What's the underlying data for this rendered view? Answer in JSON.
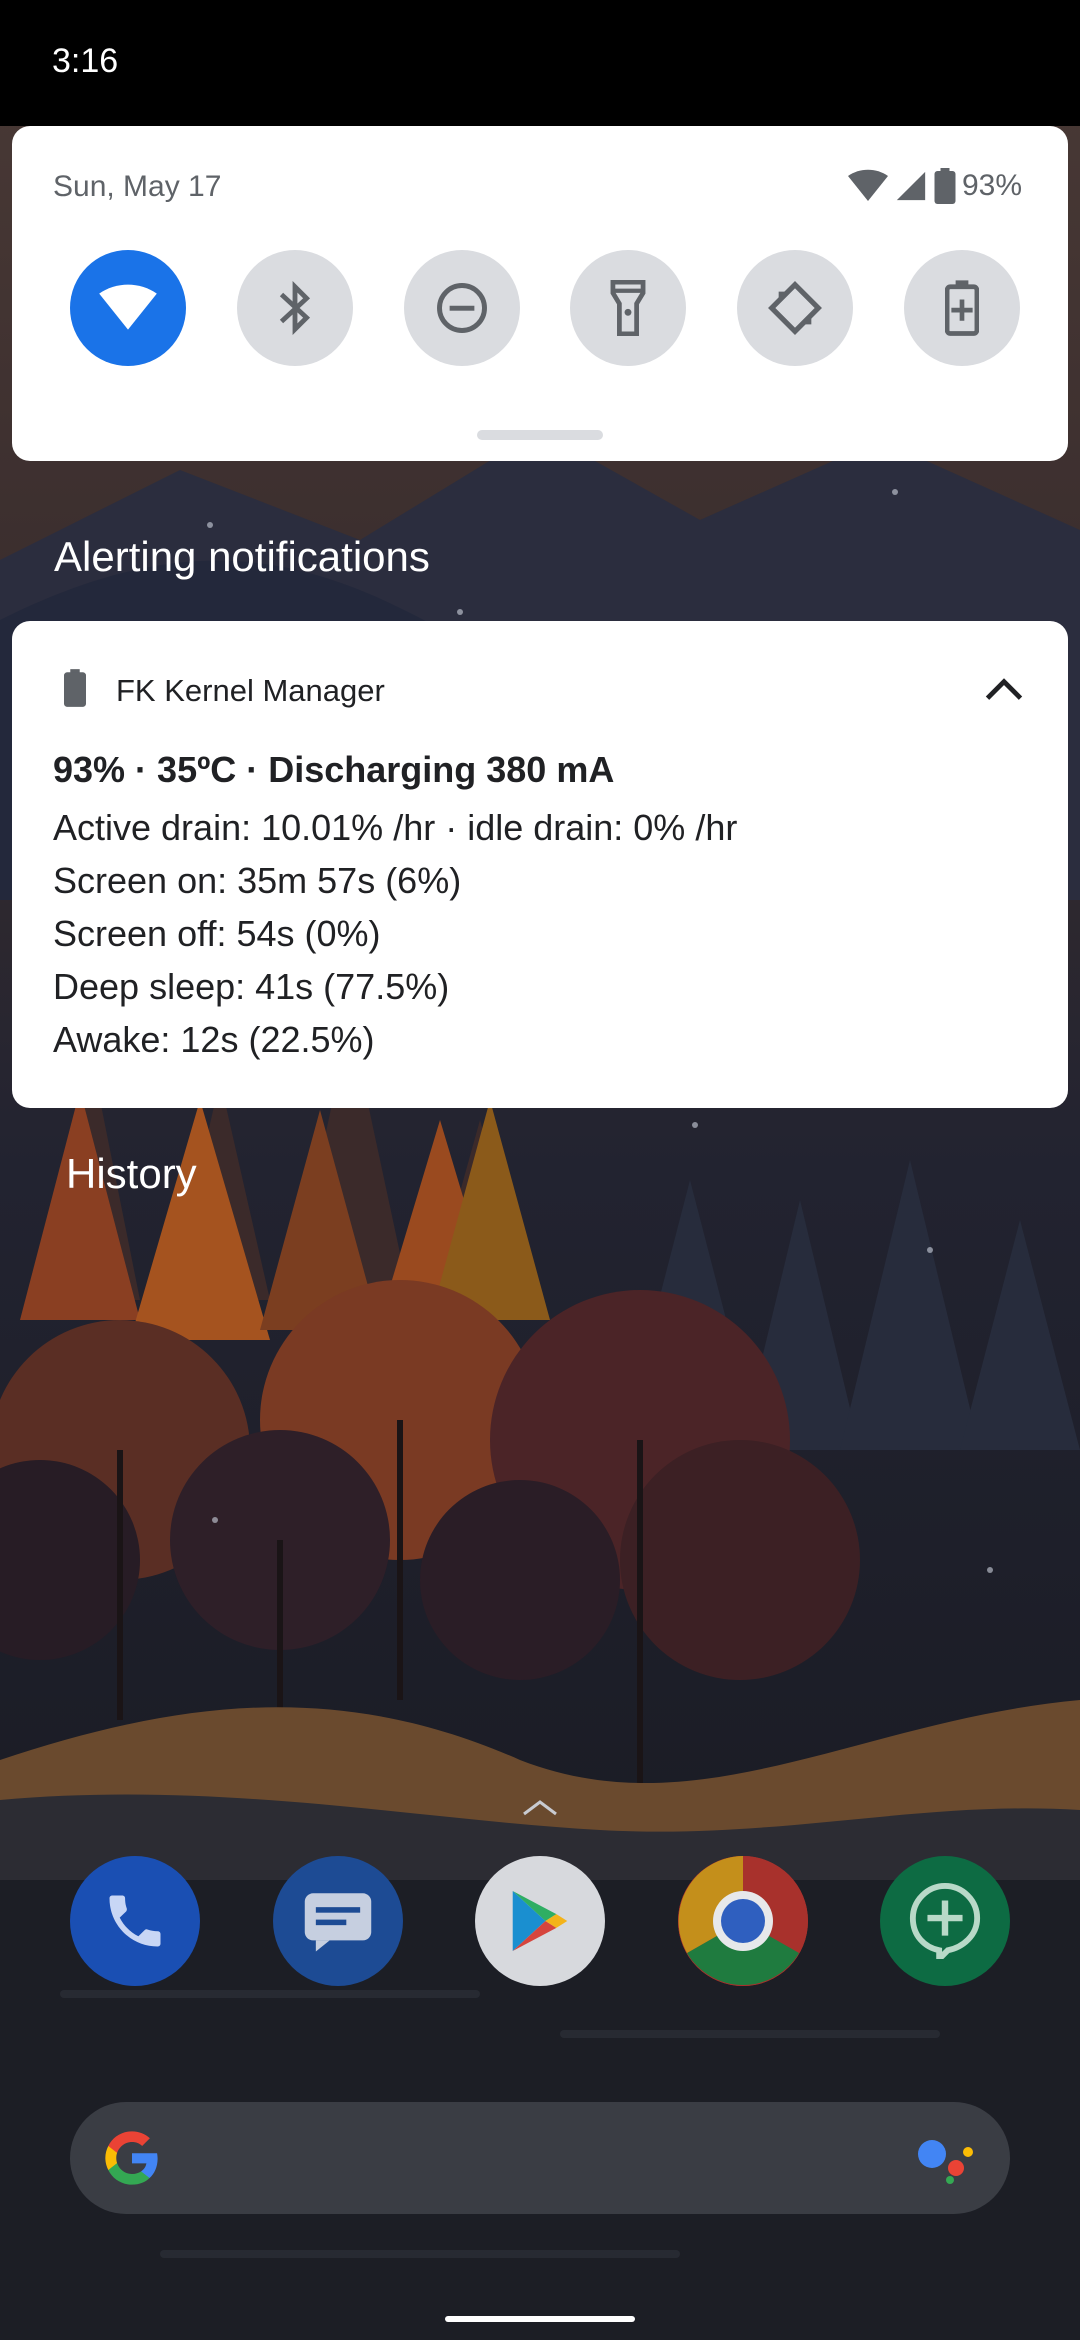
{
  "status_bar": {
    "time": "3:16"
  },
  "quick_settings": {
    "date": "Sun, May 17",
    "battery_percent": "93%",
    "tiles": [
      {
        "name": "wifi",
        "active": true
      },
      {
        "name": "bluetooth",
        "active": false
      },
      {
        "name": "do-not-disturb",
        "active": false
      },
      {
        "name": "flashlight",
        "active": false
      },
      {
        "name": "auto-rotate",
        "active": false
      },
      {
        "name": "battery-saver",
        "active": false
      }
    ]
  },
  "sections": {
    "alerting": "Alerting notifications",
    "history": "History"
  },
  "notification": {
    "app_name": "FK Kernel Manager",
    "title": "93% · 35ºC · Discharging 380 mA",
    "lines": [
      "Active drain: 10.01% /hr · idle drain: 0% /hr",
      "Screen on: 35m 57s  (6%)",
      "Screen off: 54s  (0%)",
      "Deep sleep: 41s  (77.5%)",
      "Awake: 12s  (22.5%)"
    ]
  },
  "dock": {
    "apps": [
      "phone",
      "messages",
      "play-store",
      "chrome",
      "hangouts"
    ]
  },
  "colors": {
    "accent": "#1a73e8",
    "tile_inactive": "#dadce0",
    "panel": "#ffffff",
    "status_bar": "#000000"
  }
}
